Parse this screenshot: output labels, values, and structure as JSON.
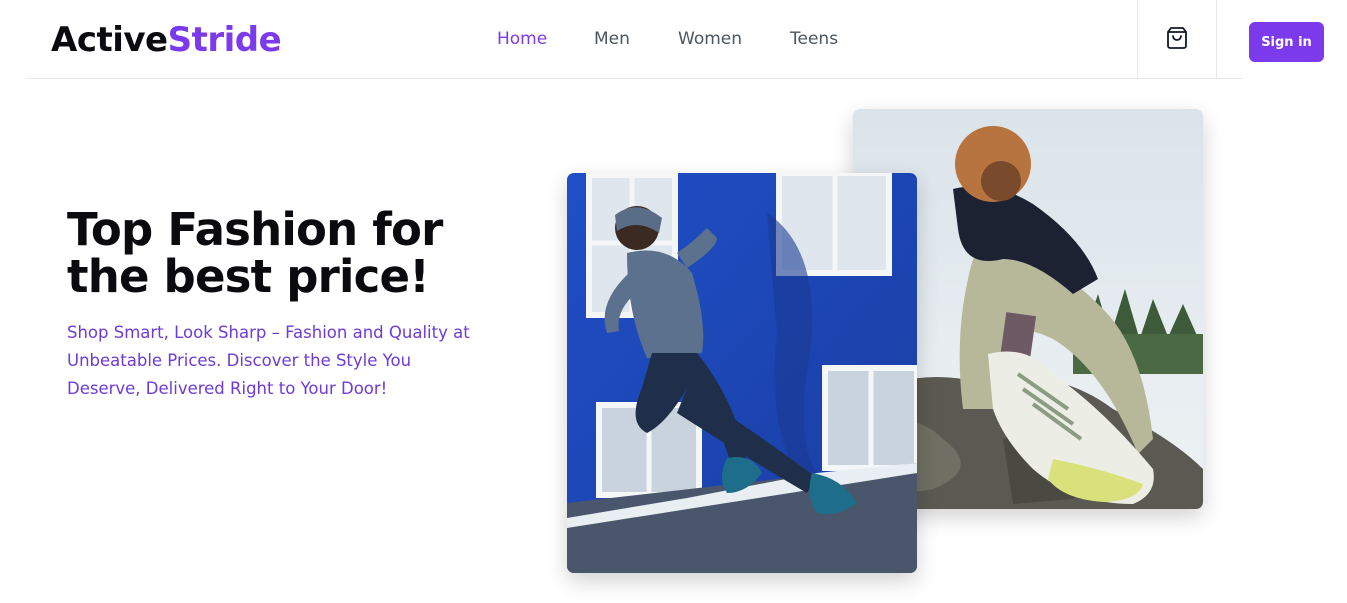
{
  "brand": {
    "part1": "Active",
    "part2": "Stride"
  },
  "nav": {
    "items": [
      {
        "label": "Home",
        "active": true
      },
      {
        "label": "Men",
        "active": false
      },
      {
        "label": "Women",
        "active": false
      },
      {
        "label": "Teens",
        "active": false
      }
    ]
  },
  "header": {
    "cart_icon": "shopping-bag-icon",
    "signin_label": "Sign in"
  },
  "hero": {
    "title_line1": "Top Fashion for",
    "title_line2": "the best price!",
    "subtitle_line1": "Shop Smart, Look Sharp – Fashion and Quality at",
    "subtitle_line2": "Unbeatable Prices. Discover the Style You",
    "subtitle_line3": "Deserve, Delivered Right to Your Door!"
  },
  "colors": {
    "accent": "#7c3aed",
    "text": "#0b0b0f",
    "nav": "#4b5563",
    "divider": "#e5e7eb"
  }
}
